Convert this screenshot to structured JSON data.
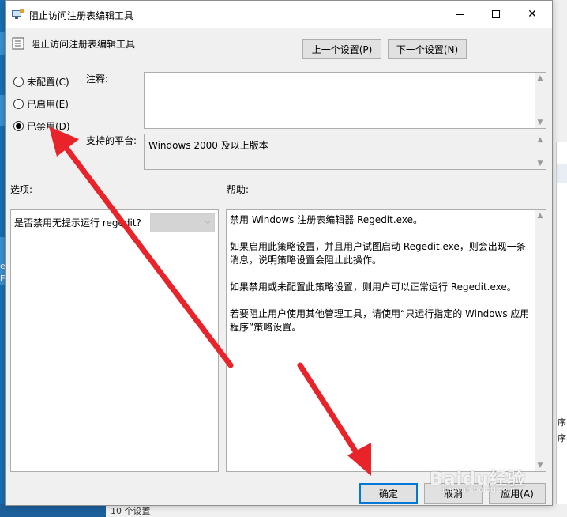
{
  "window": {
    "title": "阻止访问注册表编辑工具",
    "controls": {
      "minimize": "minimize",
      "maximize": "maximize",
      "close": "close"
    }
  },
  "policy": {
    "name": "阻止访问注册表编辑工具"
  },
  "nav_buttons": {
    "prev": "上一个设置(P)",
    "next": "下一个设置(N)"
  },
  "state_options": [
    {
      "label": "未配置(C)",
      "checked": false
    },
    {
      "label": "已启用(E)",
      "checked": false
    },
    {
      "label": "已禁用(D)",
      "checked": true
    }
  ],
  "labels": {
    "comment": "注释:",
    "platform": "支持的平台:",
    "options": "选项:",
    "help": "帮助:"
  },
  "comment_value": "",
  "platform_value": "Windows 2000 及以上版本",
  "options_panel": {
    "question": "是否禁用无提示运行 regedit?",
    "select_value": ""
  },
  "help_text": [
    "禁用 Windows 注册表编辑器 Regedit.exe。",
    "如果启用此策略设置，并且用户试图启动 Regedit.exe，则会出现一条消息，说明策略设置会阻止此操作。",
    "如果禁用或未配置此策略设置，则用户可以正常运行 Regedit.exe。",
    "若要阻止用户使用其他管理工具，请使用“只运行指定的 Windows 应用程序”策略设置。"
  ],
  "footer_buttons": {
    "ok": "确定",
    "cancel": "取消",
    "apply": "应用(A)"
  },
  "background": {
    "right_texts": [
      "序",
      "序"
    ],
    "bottom_text": "10 个设置",
    "left_texts": [
      "ec",
      "Ec"
    ]
  },
  "watermark": {
    "main": "Baidu经验",
    "sub": "jingyan.baidu.com"
  },
  "colors": {
    "arrow": "#e8242a",
    "ok_border": "#0078d7"
  }
}
